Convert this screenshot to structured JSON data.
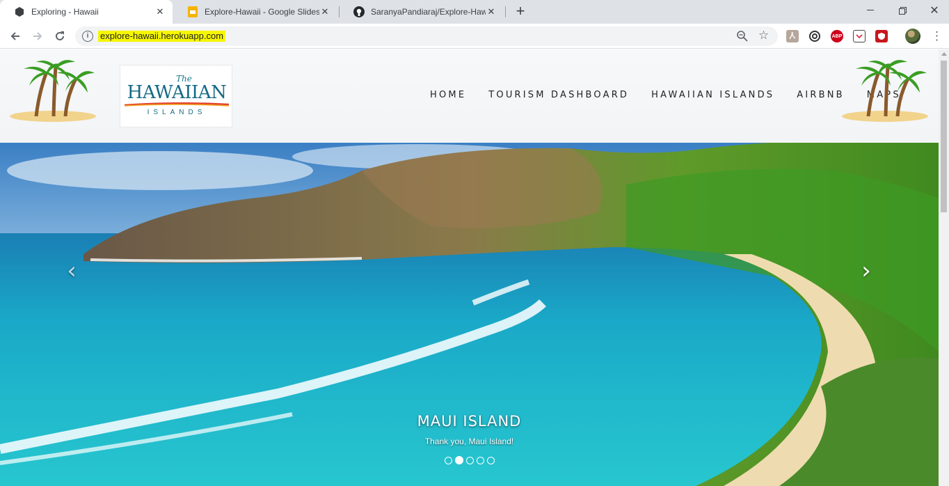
{
  "browser": {
    "tabs": [
      {
        "title": "Exploring - Hawaii",
        "favicon": "hexagon-icon",
        "active": true
      },
      {
        "title": "Explore-Hawaii - Google Slides",
        "favicon": "google-slides-icon",
        "active": false
      },
      {
        "title": "SaranyaPandiaraj/Explore-Hawaii",
        "favicon": "github-icon",
        "active": false
      }
    ],
    "address": "explore-hawaii.herokuapp.com",
    "extensions": [
      "adobe-acrobat-icon",
      "chain-icon",
      "adblock-icon",
      "pocket-icon",
      "shield-icon"
    ],
    "extension_labels": {
      "adblock": "ABP"
    }
  },
  "site": {
    "logo": {
      "the": "The",
      "name": "HAWAIIAN",
      "islands": "ISLANDS"
    },
    "nav": [
      "HOME",
      "TOURISM DASHBOARD",
      "HAWAIIAN ISLANDS",
      "AIRBNB",
      "MAPS"
    ]
  },
  "carousel": {
    "title": "MAUI ISLAND",
    "subtitle": "Thank you, Maui Island!",
    "slide_count": 5,
    "active_index": 1
  },
  "colors": {
    "highlight": "#f6f600",
    "ocean": "#1eb6cc",
    "header_bg": "#f4f6f8"
  }
}
